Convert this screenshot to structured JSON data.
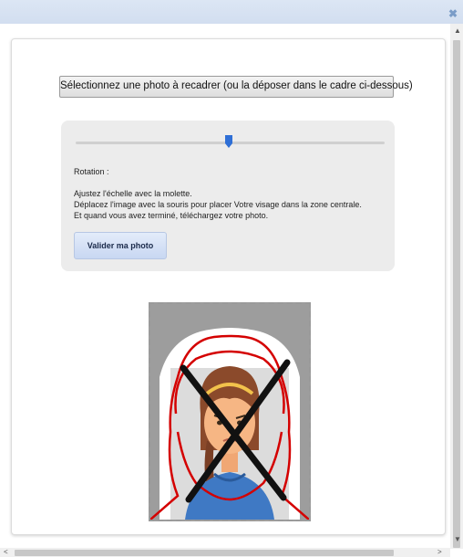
{
  "window": {
    "close_icon": "close-icon"
  },
  "select_button": {
    "label": "Sélectionnez une photo à recadrer (ou la déposer dans le cadre ci-dessous)"
  },
  "controls": {
    "scale_slider_value": 0.5,
    "rotation_label": "Rotation :",
    "instructions": [
      "Ajustez l'échelle avec la molette.",
      "Déplacez l'image avec la souris pour placer Votre visage dans la zone centrale.",
      "Et quand vous avez terminé, téléchargez votre photo."
    ],
    "validate_label": "Valider ma photo"
  },
  "colors": {
    "accent": "#2f6fd6",
    "guide_outline": "#d40000",
    "cross": "#111111",
    "frame_bg": "#9d9d9d"
  },
  "scrollbars": {
    "vertical_up": "▲",
    "vertical_down": "▼",
    "horizontal_left": "<",
    "horizontal_right": ">"
  }
}
